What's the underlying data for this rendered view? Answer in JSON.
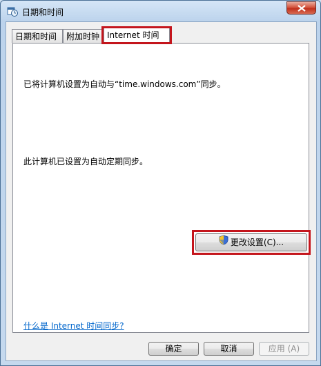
{
  "window": {
    "title": "日期和时间"
  },
  "tabs": [
    {
      "label": "日期和时间"
    },
    {
      "label": "附加时钟"
    },
    {
      "label": "Internet 时间",
      "active": true
    }
  ],
  "panel": {
    "sync_message": "已将计算机设置为自动与“time.windows.com”同步。",
    "schedule_message": "此计算机已设置为自动定期同步。",
    "change_settings_label": "更改设置(C)...",
    "help_link": "什么是 Internet 时间同步?"
  },
  "buttons": {
    "ok": "确定",
    "cancel": "取消",
    "apply": "应用 (A)"
  },
  "colors": {
    "highlight": "#c4151c",
    "link": "#0066cc",
    "close": "#c0301c"
  },
  "icons": {
    "title": "clock-calendar-icon",
    "close": "close-icon",
    "shield": "uac-shield-icon"
  }
}
